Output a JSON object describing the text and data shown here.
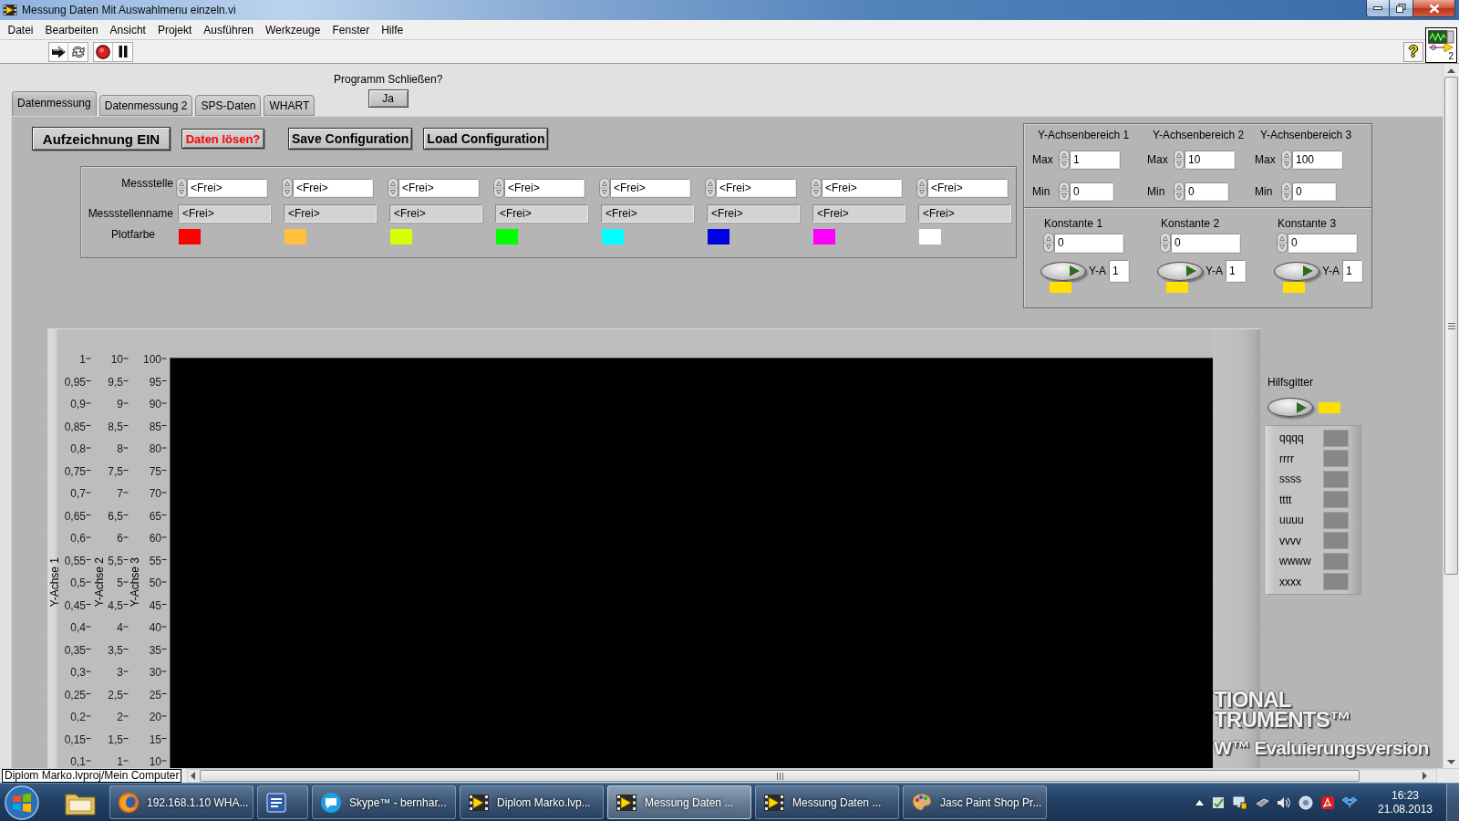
{
  "window": {
    "title": "Messung Daten Mit Auswahlmenu einzeln.vi"
  },
  "menu": [
    "Datei",
    "Bearbeiten",
    "Ansicht",
    "Projekt",
    "Ausführen",
    "Werkzeuge",
    "Fenster",
    "Hilfe"
  ],
  "toolbar": {
    "help_symbol": "?"
  },
  "vi_icon": {
    "number": "2"
  },
  "tabs": [
    {
      "label": "Datenmessung",
      "selected": true
    },
    {
      "label": "Datenmessung 2",
      "selected": false
    },
    {
      "label": "SPS-Daten",
      "selected": false
    },
    {
      "label": "WHART",
      "selected": false
    }
  ],
  "close_prompt": {
    "label": "Programm Schließen?",
    "button": "Ja"
  },
  "buttons": [
    {
      "label": "Aufzeichnung EIN",
      "kind": "large"
    },
    {
      "label": "Daten lösen?",
      "kind": "alert"
    },
    {
      "label": "Save Configuration",
      "kind": "normal"
    },
    {
      "label": "Load Configuration",
      "kind": "normal"
    }
  ],
  "channels": {
    "labels": {
      "point": "Messstelle",
      "name": "Messstellenname",
      "plot_swatch": "Plotfarbe"
    },
    "items": [
      {
        "point": "<Frei>",
        "name": "<Frei>",
        "color": "#ff0000"
      },
      {
        "point": "<Frei>",
        "name": "<Frei>",
        "color": "#ffc040"
      },
      {
        "point": "<Frei>",
        "name": "<Frei>",
        "color": "#d8ff00"
      },
      {
        "point": "<Frei>",
        "name": "<Frei>",
        "color": "#00ff00"
      },
      {
        "point": "<Frei>",
        "name": "<Frei>",
        "color": "#00ffff"
      },
      {
        "point": "<Frei>",
        "name": "<Frei>",
        "color": "#0000e0"
      },
      {
        "point": "<Frei>",
        "name": "<Frei>",
        "color": "#ff00ff"
      },
      {
        "point": "<Frei>",
        "name": "<Frei>",
        "color": "#ffffff"
      }
    ]
  },
  "y_ranges": [
    {
      "title": "Y-Achsenbereich 1",
      "max_label": "Max",
      "max": "1",
      "min_label": "Min",
      "min": "0"
    },
    {
      "title": "Y-Achsenbereich 2",
      "max_label": "Max",
      "max": "10",
      "min_label": "Min",
      "min": "0"
    },
    {
      "title": "Y-Achsenbereich 3",
      "max_label": "Max",
      "max": "100",
      "min_label": "Min",
      "min": "0"
    }
  ],
  "constants": [
    {
      "title": "Konstante 1",
      "value": "0",
      "axis_label": "Y-A",
      "axis": "1"
    },
    {
      "title": "Konstante 2",
      "value": "0",
      "axis_label": "Y-A",
      "axis": "1"
    },
    {
      "title": "Konstante 3",
      "value": "0",
      "axis_label": "Y-A",
      "axis": "1"
    }
  ],
  "graph": {
    "axes": [
      {
        "label": "Y-Achse 1",
        "ticks": [
          "1",
          "0,95",
          "0,9",
          "0,85",
          "0,8",
          "0,75",
          "0,7",
          "0,65",
          "0,6",
          "0,55",
          "0,5",
          "0,45",
          "0,4",
          "0,35",
          "0,3",
          "0,25",
          "0,2",
          "0,15",
          "0,1"
        ]
      },
      {
        "label": "Y-Achse 2",
        "ticks": [
          "10",
          "9,5",
          "9",
          "8,5",
          "8",
          "7,5",
          "7",
          "6,5",
          "6",
          "5,5",
          "5",
          "4,5",
          "4",
          "3,5",
          "3",
          "2,5",
          "2",
          "1,5",
          "1"
        ]
      },
      {
        "label": "Y-Achse 3",
        "ticks": [
          "100",
          "95",
          "90",
          "85",
          "80",
          "75",
          "70",
          "65",
          "60",
          "55",
          "50",
          "45",
          "40",
          "35",
          "30",
          "25",
          "20",
          "15",
          "10"
        ]
      }
    ]
  },
  "legend": {
    "title": "Hilfsgitter",
    "items": [
      "qqqq",
      "rrrr",
      "ssss",
      "tttt",
      "uuuu",
      "vvvv",
      "wwww",
      "xxxx"
    ]
  },
  "watermark": [
    "TIONAL",
    "TRUMENTS™",
    "W™ Evaluierungsversion"
  ],
  "status_bar": {
    "path": "Diplom Marko.lvproj/Mein Computer"
  },
  "taskbar": {
    "windows": [
      {
        "kind": "firefox",
        "label": "192.168.1.10 WHA...",
        "selected": false
      },
      {
        "kind": "word",
        "selected": false
      },
      {
        "kind": "skype",
        "label": "Skype™ - bernhar...",
        "selected": false
      },
      {
        "kind": "labview",
        "label": "Diplom Marko.lvp...",
        "selected": false
      },
      {
        "kind": "labview",
        "label": "Messung Daten ...",
        "selected": true
      },
      {
        "kind": "labview",
        "label": "Messung Daten ...",
        "selected": false
      },
      {
        "kind": "paintshop",
        "label": "Jasc Paint Shop Pr...",
        "selected": false
      }
    ],
    "clock": {
      "time": "16:23",
      "date": "21.08.2013"
    }
  }
}
